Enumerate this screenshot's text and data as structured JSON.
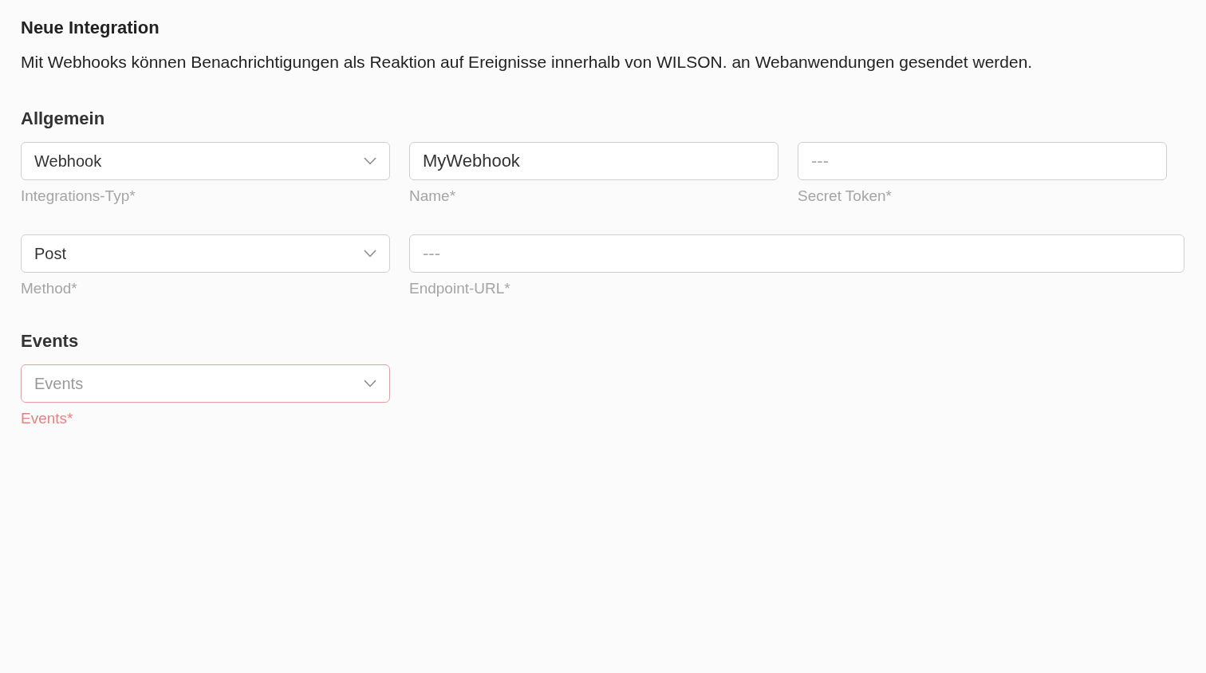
{
  "title": "Neue Integration",
  "description": "Mit Webhooks können Benachrichtigungen als Reaktion auf Ereignisse innerhalb von WILSON. an Webanwendungen gesendet werden.",
  "sections": [
    {
      "heading": "Allgemein",
      "rows": [
        [
          {
            "kind": "select",
            "value": "Webhook",
            "label": "Integrations-Typ*",
            "error": false,
            "wide": false
          },
          {
            "kind": "text",
            "value": "MyWebhook",
            "label": "Name*",
            "error": false,
            "wide": false
          },
          {
            "kind": "text",
            "placeholder": "---",
            "label": "Secret Token*",
            "error": false,
            "wide": false
          }
        ],
        [
          {
            "kind": "select",
            "value": "Post",
            "label": "Method*",
            "error": false,
            "wide": false
          },
          {
            "kind": "text",
            "placeholder": "---",
            "label": "Endpoint-URL*",
            "error": false,
            "wide": true
          }
        ]
      ]
    },
    {
      "heading": "Events",
      "rows": [
        [
          {
            "kind": "select",
            "placeholder": "Events",
            "label": "Events*",
            "error": true,
            "wide": false
          }
        ]
      ]
    }
  ]
}
